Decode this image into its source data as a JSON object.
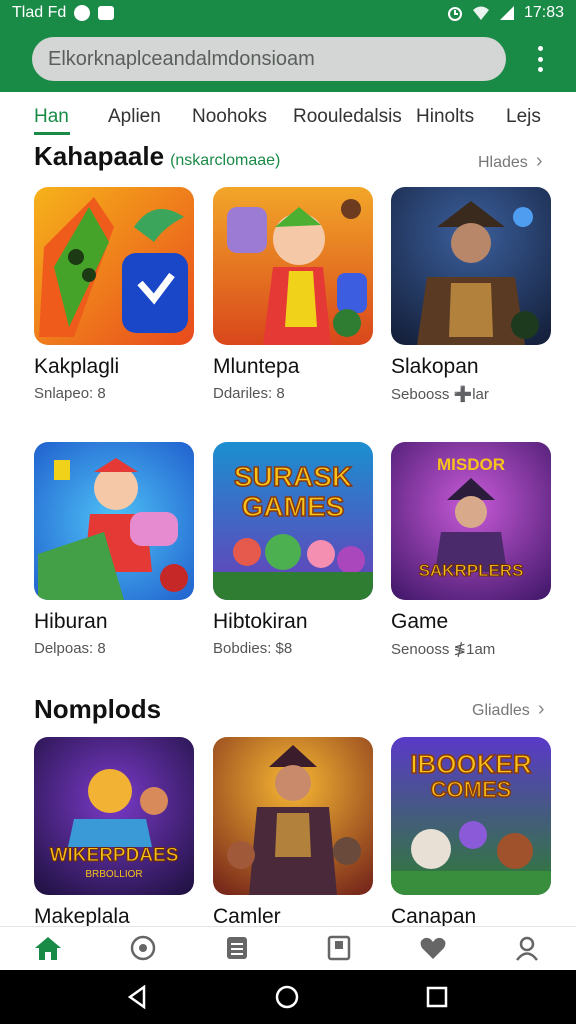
{
  "status_bar": {
    "left_text": "Tlad Fd",
    "time": "17:83"
  },
  "search": {
    "text": "Elkorknaplceandalmdonsioam"
  },
  "tabs": [
    {
      "label": "Han",
      "active": true
    },
    {
      "label": "Aplien",
      "active": false
    },
    {
      "label": "Noohoks",
      "active": false
    },
    {
      "label": "Roouledalsis",
      "active": false
    },
    {
      "label": "Hinolts",
      "active": false
    },
    {
      "label": "Lejs",
      "active": false
    }
  ],
  "section1": {
    "title": "Kahapaale",
    "subtitle": "(nskarclomaae)",
    "see_all": "Hlades"
  },
  "section2": {
    "title": "Nomplods",
    "see_all": "Gliadles"
  },
  "cards": [
    {
      "title": "Kakplagli",
      "subtitle": "Snlapeo: 8"
    },
    {
      "title": "Mluntepa",
      "subtitle": "Ddariles: 8"
    },
    {
      "title": "Slakopan",
      "subtitle": "Sebooss ➕lar"
    },
    {
      "title": "Hiburan",
      "subtitle": "Delpoas: 8"
    },
    {
      "title": "Hibtokiran",
      "subtitle": "Bobdies: $8"
    },
    {
      "title": "Game",
      "subtitle": "Senooss ≸1am"
    },
    {
      "title": "Makeplala",
      "subtitle": ""
    },
    {
      "title": "Camler",
      "subtitle": ""
    },
    {
      "title": "Canapan",
      "subtitle": ""
    }
  ],
  "thumb_text": {
    "surask": "SURASK",
    "games": "GAMES",
    "misdor": "MISDOR",
    "sakrplers": "SAKRPLERS",
    "wikerpdaes": "WIKERPDAES",
    "wik_sub": "BRBOLLIOR",
    "ibooker": "IBOOKER",
    "comes": "COMES"
  },
  "colors": {
    "brand_green": "#1a8a47",
    "search_bg": "#d3d6d4"
  },
  "bottom_nav": [
    "home-icon",
    "compass-icon",
    "list-icon",
    "library-icon",
    "heart-icon",
    "profile-icon"
  ]
}
